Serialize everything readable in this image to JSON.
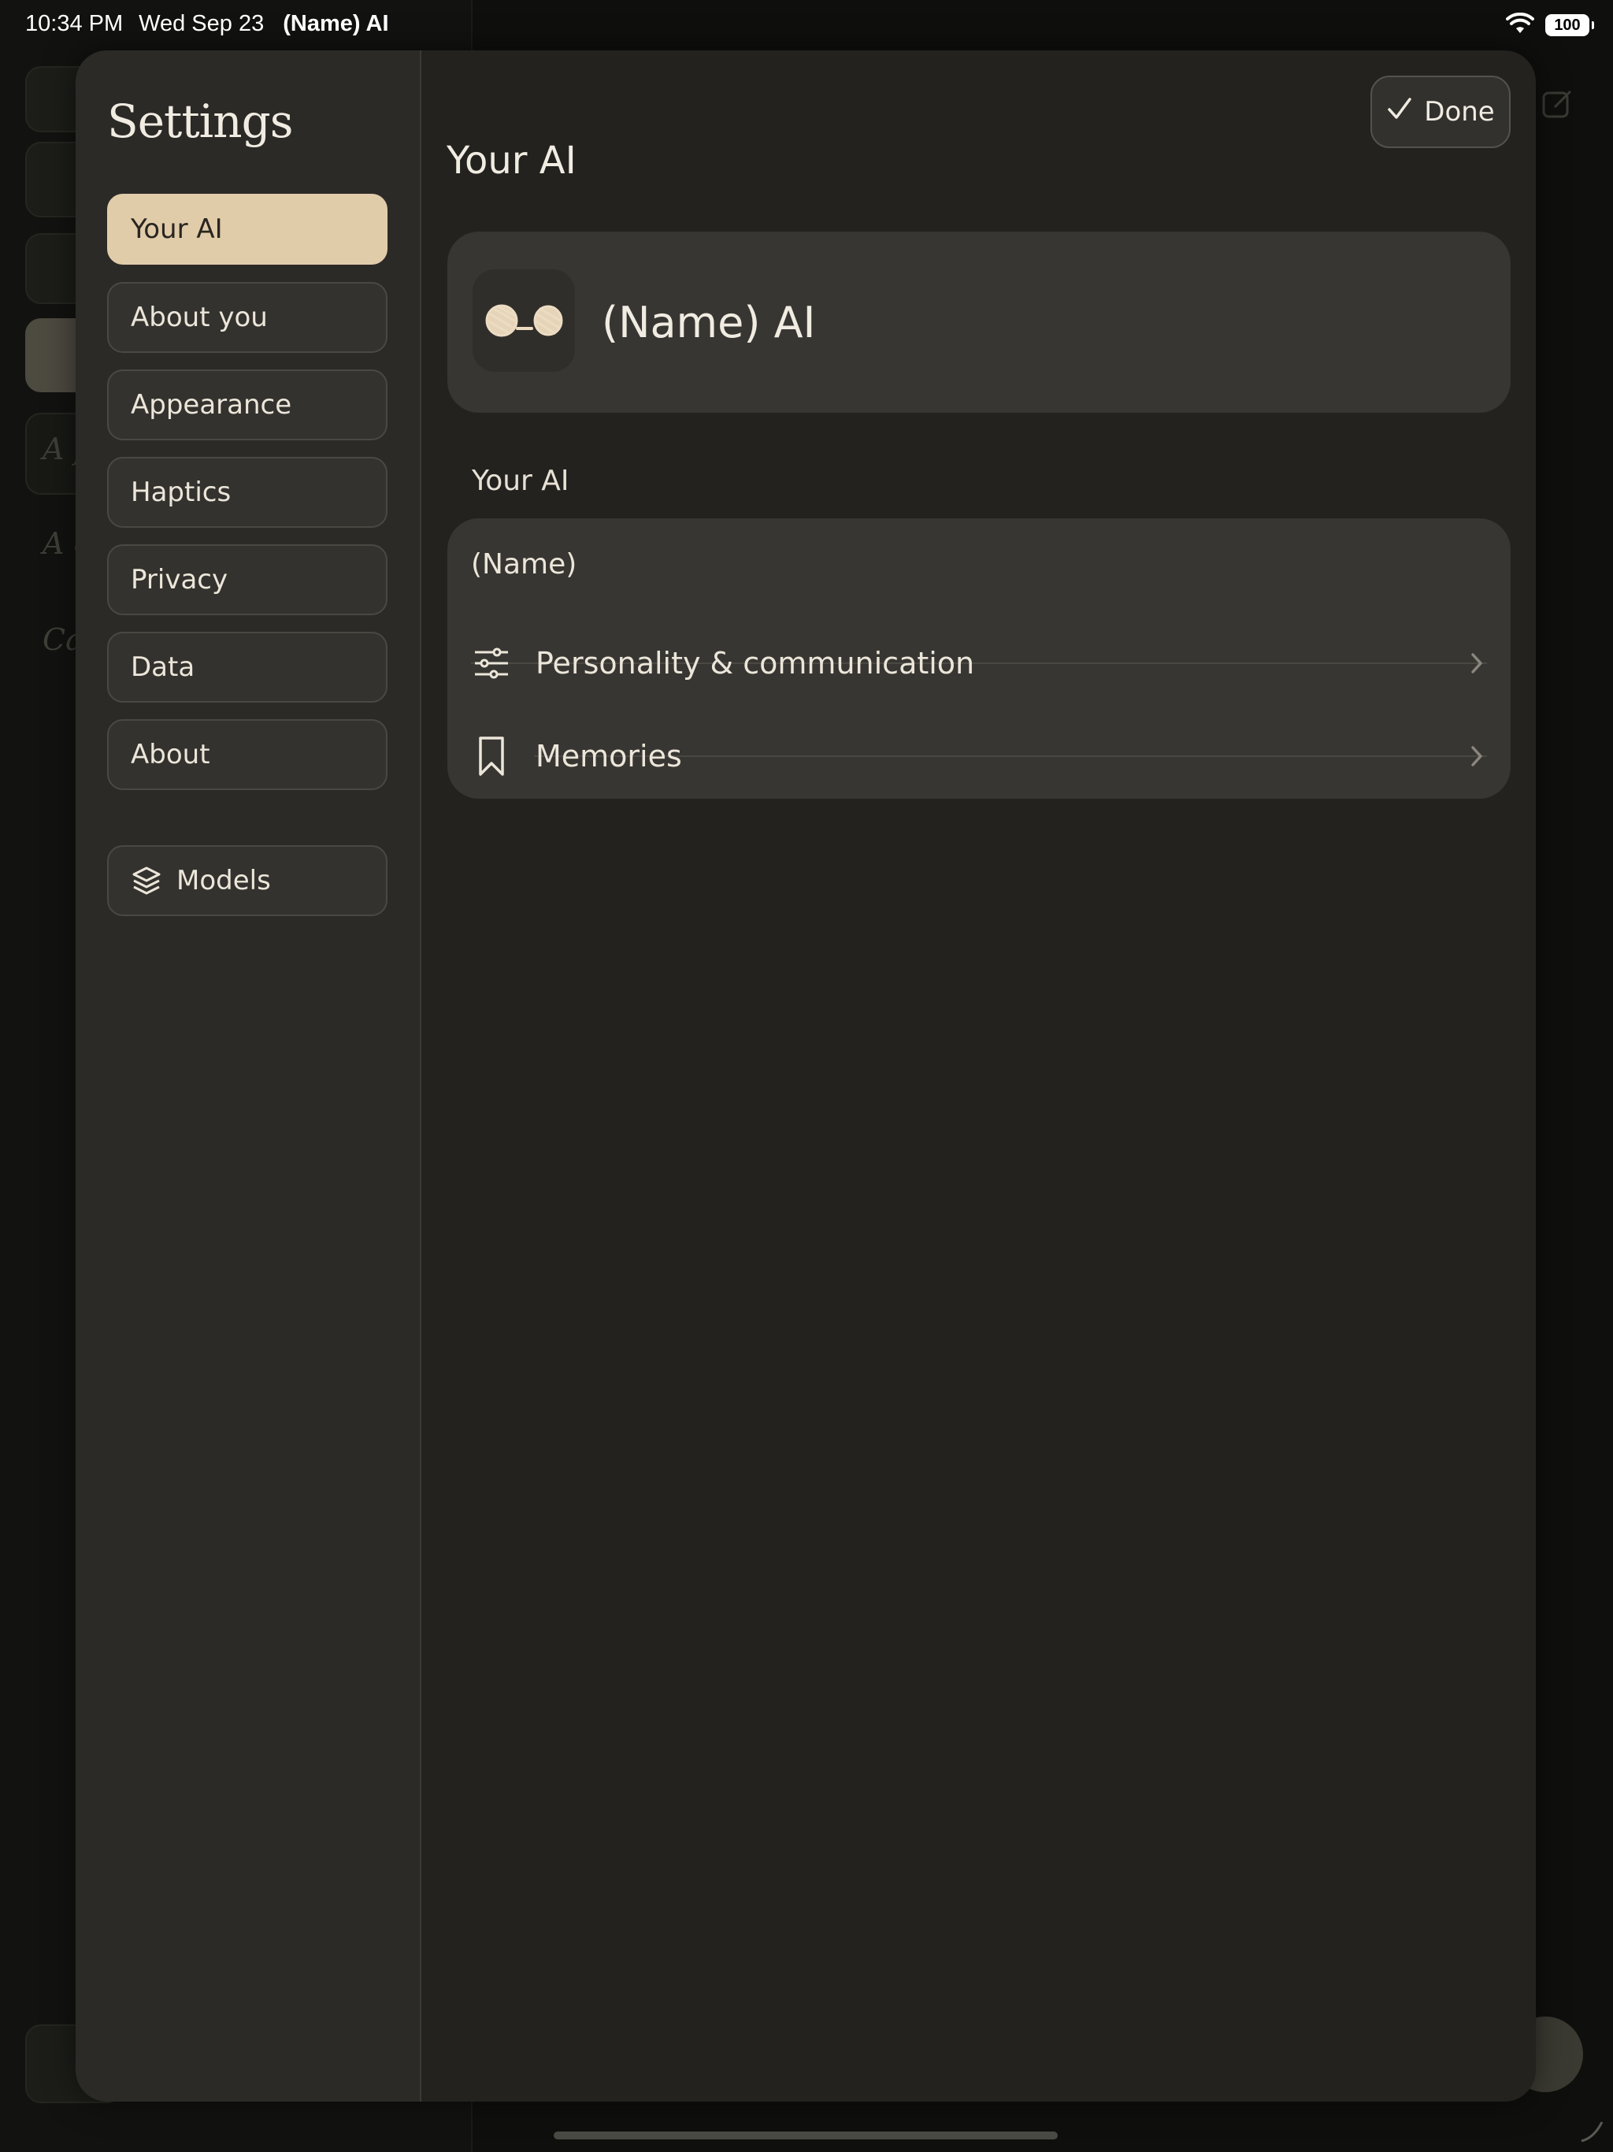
{
  "status_bar": {
    "time": "10:34 PM",
    "date": "Wed Sep 23",
    "app_name": "(Name) AI",
    "battery": "100"
  },
  "settings": {
    "title": "Settings",
    "nav_items": [
      {
        "label": "Your AI",
        "active": true
      },
      {
        "label": "About you"
      },
      {
        "label": "Appearance"
      },
      {
        "label": "Haptics"
      },
      {
        "label": "Privacy"
      },
      {
        "label": "Data"
      },
      {
        "label": "About"
      }
    ],
    "models_label": "Models"
  },
  "content": {
    "title": "Your AI",
    "done_label": "Done",
    "profile_name": "(Name) AI",
    "section_label": "Your AI",
    "name_field": "(Name)",
    "rows": [
      {
        "label": "Personality & communication",
        "icon": "sliders-icon"
      },
      {
        "label": "Memories",
        "icon": "bookmark-icon"
      }
    ]
  },
  "background_app": {
    "list_fragments": [
      "A f",
      "A c",
      "Ca"
    ]
  },
  "colors": {
    "accent": "#e1ccaa",
    "sheet_bg": "#23221f",
    "sidebar_bg": "#2c2a27",
    "card_bg": "#383632"
  }
}
